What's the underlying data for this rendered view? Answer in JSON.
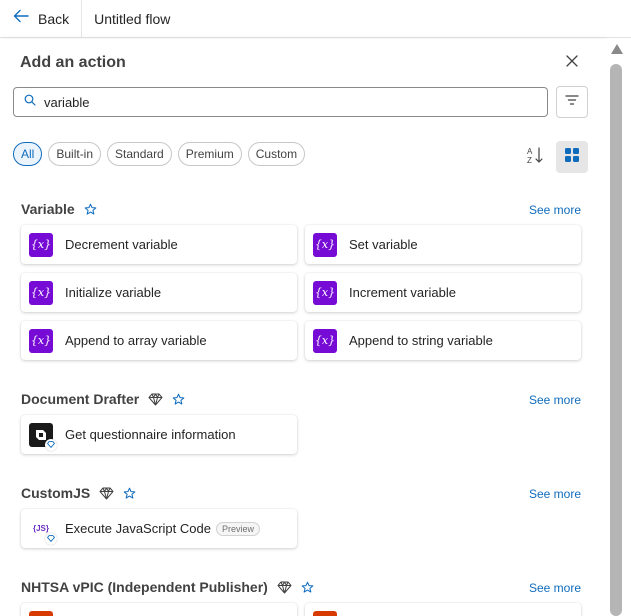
{
  "topbar": {
    "back_label": "Back",
    "flow_title": "Untitled flow"
  },
  "panel": {
    "title": "Add an action",
    "search": {
      "value": "variable",
      "placeholder": ""
    },
    "chips": [
      {
        "label": "All",
        "active": true
      },
      {
        "label": "Built-in",
        "active": false
      },
      {
        "label": "Standard",
        "active": false
      },
      {
        "label": "Premium",
        "active": false
      },
      {
        "label": "Custom",
        "active": false
      }
    ],
    "see_more_label": "See more"
  },
  "sections": [
    {
      "title": "Variable",
      "premium": false,
      "see_more": "See more",
      "actions": [
        {
          "label": "Decrement variable",
          "icon": "variable-icon"
        },
        {
          "label": "Set variable",
          "icon": "variable-icon"
        },
        {
          "label": "Initialize variable",
          "icon": "variable-icon"
        },
        {
          "label": "Increment variable",
          "icon": "variable-icon"
        },
        {
          "label": "Append to array variable",
          "icon": "variable-icon"
        },
        {
          "label": "Append to string variable",
          "icon": "variable-icon"
        }
      ]
    },
    {
      "title": "Document Drafter",
      "premium": true,
      "see_more": "See more",
      "actions": [
        {
          "label": "Get questionnaire information",
          "icon": "document-drafter-icon"
        }
      ]
    },
    {
      "title": "CustomJS",
      "premium": true,
      "see_more": "See more",
      "actions": [
        {
          "label": "Execute JavaScript Code",
          "icon": "customjs-icon",
          "badge": "Preview"
        }
      ]
    },
    {
      "title": "NHTSA vPIC (Independent Publisher)",
      "premium": true,
      "see_more": "See more",
      "actions": [
        {
          "label": "",
          "icon": "nhtsa-icon"
        },
        {
          "label": "",
          "icon": "nhtsa-icon"
        }
      ]
    }
  ],
  "icon_texts": {
    "variable": "{x}",
    "js": "{JS}"
  },
  "colors": {
    "accent": "#0f6cbd",
    "variable_icon": "#770bd6",
    "nhtsa_icon": "#d83b01"
  }
}
